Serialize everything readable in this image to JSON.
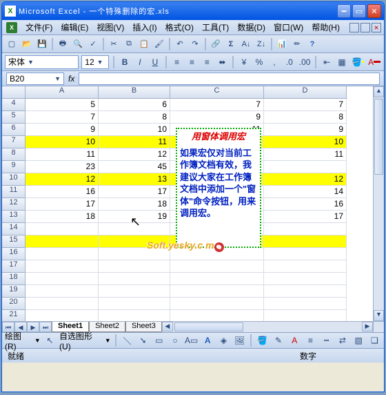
{
  "title": "Microsoft Excel - 一个特殊删除的宏.xls",
  "menu": {
    "file": "文件(F)",
    "edit": "编辑(E)",
    "view": "视图(V)",
    "insert": "插入(I)",
    "format": "格式(O)",
    "tools": "工具(T)",
    "data": "数据(D)",
    "window": "窗口(W)",
    "help": "帮助(H)"
  },
  "format_bar": {
    "font": "宋体",
    "size": "12",
    "bold": "B",
    "italic": "I",
    "underline": "U",
    "currency": "¥",
    "percent": "%"
  },
  "namebox": "B20",
  "fx": "fx",
  "columns": [
    "A",
    "B",
    "C",
    "D"
  ],
  "rows": [
    {
      "n": "4",
      "hl": false,
      "c": [
        "5",
        "6",
        "7",
        "7"
      ]
    },
    {
      "n": "5",
      "hl": false,
      "c": [
        "7",
        "8",
        "9",
        "8"
      ]
    },
    {
      "n": "6",
      "hl": false,
      "c": [
        "9",
        "10",
        "11",
        "9"
      ]
    },
    {
      "n": "7",
      "hl": true,
      "c": [
        "10",
        "11",
        "",
        "10"
      ]
    },
    {
      "n": "8",
      "hl": false,
      "c": [
        "11",
        "12",
        "",
        "11"
      ]
    },
    {
      "n": "9",
      "hl": false,
      "c": [
        "23",
        "45",
        "",
        ""
      ]
    },
    {
      "n": "10",
      "hl": true,
      "c": [
        "12",
        "13",
        "",
        "12"
      ]
    },
    {
      "n": "11",
      "hl": false,
      "c": [
        "16",
        "17",
        "",
        "14"
      ]
    },
    {
      "n": "12",
      "hl": false,
      "c": [
        "17",
        "18",
        "",
        "16"
      ]
    },
    {
      "n": "13",
      "hl": false,
      "c": [
        "18",
        "19",
        "",
        "17"
      ]
    },
    {
      "n": "14",
      "hl": false,
      "c": [
        "",
        "",
        "",
        ""
      ]
    },
    {
      "n": "15",
      "hl": true,
      "c": [
        "",
        "",
        "",
        ""
      ]
    },
    {
      "n": "16",
      "hl": false,
      "c": [
        "",
        "",
        "",
        ""
      ]
    },
    {
      "n": "17",
      "hl": false,
      "c": [
        "",
        "",
        "",
        ""
      ]
    },
    {
      "n": "18",
      "hl": false,
      "c": [
        "",
        "",
        "",
        ""
      ]
    },
    {
      "n": "19",
      "hl": false,
      "c": [
        "",
        "",
        "",
        ""
      ]
    },
    {
      "n": "20",
      "hl": false,
      "c": [
        "",
        "",
        "",
        ""
      ]
    },
    {
      "n": "21",
      "hl": false,
      "c": [
        "",
        "",
        "",
        ""
      ]
    }
  ],
  "textbox": {
    "title": "用窗体调用宏",
    "body": "如果宏仅对当前工作簿文档有效，我建议大家在工作簿文档中添加一个\"窗体\"命令按钮，用来调用宏。"
  },
  "watermark": "Soft.yesky.c   m",
  "sheets": [
    "Sheet1",
    "Sheet2",
    "Sheet3"
  ],
  "active_sheet": 0,
  "draw_bar": {
    "label": "绘图(R)",
    "autoshape": "自选图形(U)"
  },
  "status": {
    "ready": "就绪",
    "mode": "数字"
  }
}
